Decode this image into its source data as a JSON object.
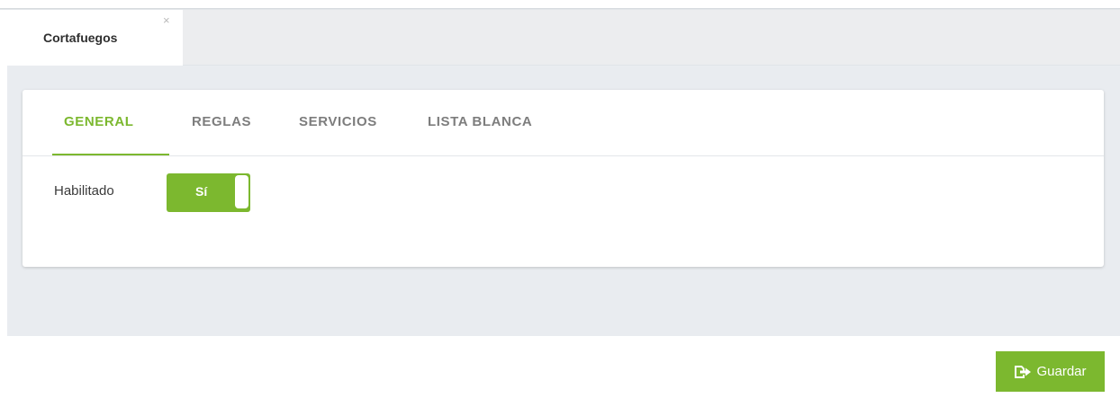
{
  "document_tab": {
    "title": "Cortafuegos",
    "close_glyph": "×"
  },
  "tabs": [
    {
      "label": "GENERAL",
      "active": true
    },
    {
      "label": "REGLAS",
      "active": false
    },
    {
      "label": "SERVICIOS",
      "active": false
    },
    {
      "label": "LISTA BLANCA",
      "active": false
    }
  ],
  "general": {
    "enabled_label": "Habilitado",
    "enabled_value": "Sí",
    "enabled": true
  },
  "footer": {
    "save_label": "Guardar",
    "save_icon": "save-arrow-icon"
  },
  "colors": {
    "accent": "#7cb82f",
    "tab_inactive": "#7d7d7d",
    "content_bg": "#e9ecf0"
  }
}
